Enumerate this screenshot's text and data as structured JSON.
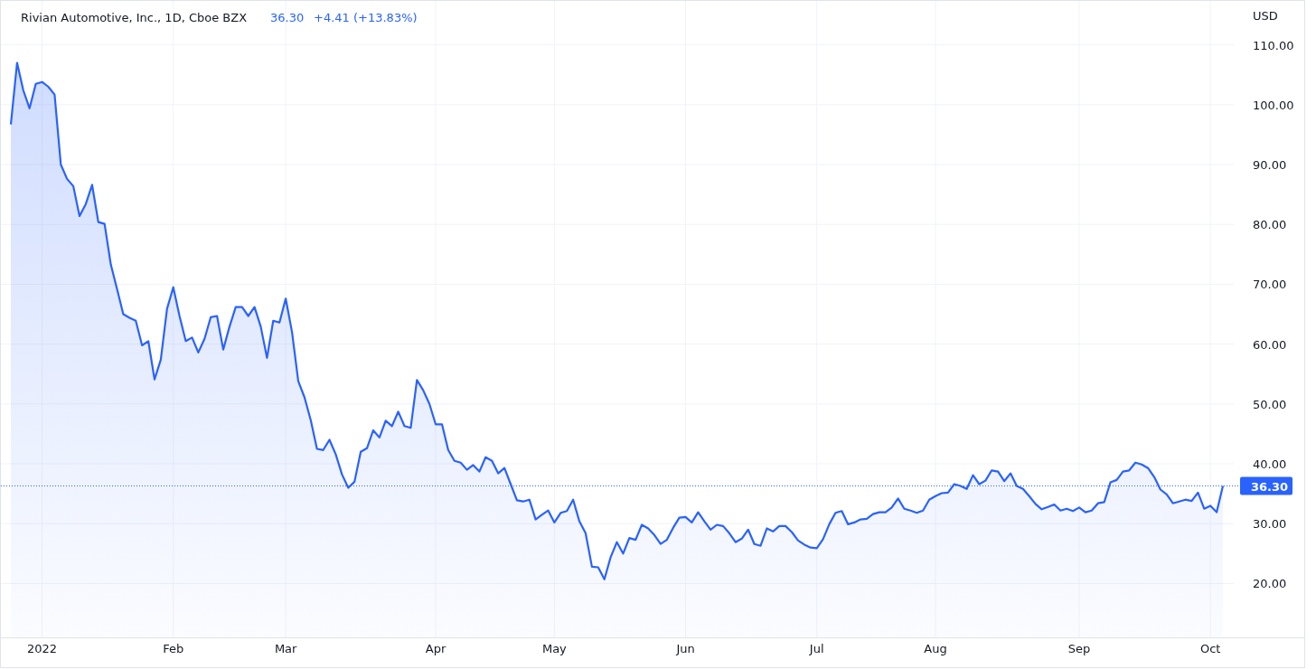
{
  "header": {
    "title": "Rivian Automotive, Inc., 1D, Cboe BZX",
    "price": "36.30",
    "change": "+4.41 (+13.83%)"
  },
  "chart": {
    "currency": "USD",
    "chart_data": {
      "type": "area",
      "grid": true,
      "ylim": [
        11,
        117.5
      ],
      "ref_lines": [
        {
          "axis": "y",
          "value": 36.3,
          "label": "36.30",
          "color": "#2962ff"
        }
      ],
      "categories": [
        null,
        null,
        null,
        null,
        null,
        "2022",
        null,
        null,
        null,
        null,
        null,
        null,
        null,
        null,
        null,
        null,
        null,
        null,
        null,
        null,
        null,
        null,
        null,
        null,
        null,
        null,
        "Feb",
        null,
        null,
        null,
        null,
        null,
        null,
        null,
        null,
        null,
        null,
        null,
        null,
        null,
        null,
        null,
        null,
        null,
        "Mar",
        null,
        null,
        null,
        null,
        null,
        null,
        null,
        null,
        null,
        null,
        null,
        null,
        null,
        null,
        null,
        null,
        null,
        null,
        null,
        null,
        null,
        null,
        null,
        "Apr",
        null,
        null,
        null,
        null,
        null,
        null,
        null,
        null,
        null,
        null,
        null,
        null,
        null,
        null,
        null,
        null,
        null,
        null,
        "May",
        null,
        null,
        null,
        null,
        null,
        null,
        null,
        null,
        null,
        null,
        null,
        null,
        null,
        null,
        null,
        null,
        null,
        null,
        null,
        null,
        "Jun",
        null,
        null,
        null,
        null,
        null,
        null,
        null,
        null,
        null,
        null,
        null,
        null,
        null,
        null,
        null,
        null,
        null,
        null,
        null,
        null,
        "Jul",
        null,
        null,
        null,
        null,
        null,
        null,
        null,
        null,
        null,
        null,
        null,
        null,
        null,
        null,
        null,
        null,
        null,
        null,
        "Aug",
        null,
        null,
        null,
        null,
        null,
        null,
        null,
        null,
        null,
        null,
        null,
        null,
        null,
        null,
        null,
        null,
        null,
        null,
        null,
        null,
        null,
        null,
        "Sep",
        null,
        null,
        null,
        null,
        null,
        null,
        null,
        null,
        null,
        null,
        null,
        null,
        null,
        null,
        null,
        null,
        null,
        null,
        null,
        null,
        "Oct",
        null,
        null
      ],
      "yticks": [
        {
          "value": 20,
          "label": "20.00"
        },
        {
          "value": 30,
          "label": "30.00"
        },
        {
          "value": 40,
          "label": "40.00"
        },
        {
          "value": 50,
          "label": "50.00"
        },
        {
          "value": 60,
          "label": "60.00"
        },
        {
          "value": 70,
          "label": "70.00"
        },
        {
          "value": 80,
          "label": "80.00"
        },
        {
          "value": 90,
          "label": "90.00"
        },
        {
          "value": 100,
          "label": "100.00"
        },
        {
          "value": 110,
          "label": "110.00"
        }
      ],
      "series": [
        {
          "color": "#2962ff",
          "values": [
            96.7,
            107,
            102.4,
            99.4,
            103.5,
            103.8,
            103,
            101.7,
            90,
            87.6,
            86.4,
            81.4,
            83.4,
            86.6,
            80.4,
            80.1,
            73.3,
            69.2,
            65,
            64.4,
            63.9,
            59.8,
            60.5,
            54.1,
            57.4,
            65.9,
            69.5,
            64.7,
            60.5,
            61.1,
            58.6,
            60.9,
            64.5,
            64.7,
            59.1,
            62.9,
            66.2,
            66.2,
            64.7,
            66.2,
            62.9,
            57.7,
            63.9,
            63.6,
            67.6,
            62,
            53.8,
            51.1,
            47.3,
            42.5,
            42.3,
            44,
            41.6,
            38.2,
            36,
            37,
            42,
            42.6,
            45.6,
            44.4,
            47.2,
            46.3,
            48.7,
            46.3,
            46,
            54,
            52.3,
            50,
            46.6,
            46.6,
            42.3,
            40.5,
            40.2,
            39,
            39.8,
            38.7,
            41.1,
            40.5,
            38.4,
            39.3,
            36.6,
            33.9,
            33.7,
            34,
            30.7,
            31.5,
            32.2,
            30.2,
            31.8,
            32.1,
            34,
            30.4,
            28.4,
            22.8,
            22.7,
            20.7,
            24.4,
            26.9,
            25,
            27.6,
            27.3,
            29.8,
            29.2,
            28.1,
            26.6,
            27.3,
            29.3,
            31,
            31.1,
            30.2,
            31.9,
            30.4,
            29,
            29.8,
            29.6,
            28.4,
            26.9,
            27.5,
            29,
            26.6,
            26.3,
            29.2,
            28.7,
            29.6,
            29.6,
            28.6,
            27.2,
            26.5,
            26,
            25.9,
            27.4,
            29.9,
            31.8,
            32.1,
            29.9,
            30.2,
            30.7,
            30.8,
            31.6,
            31.9,
            31.9,
            32.7,
            34.2,
            32.5,
            32.2,
            31.8,
            32.2,
            34,
            34.6,
            35.1,
            35.2,
            36.6,
            36.3,
            35.8,
            38.1,
            36.6,
            37.2,
            38.9,
            38.7,
            37.1,
            38.4,
            36.3,
            35.8,
            34.6,
            33.3,
            32.4,
            32.8,
            33.2,
            32.2,
            32.5,
            32.1,
            32.7,
            31.9,
            32.2,
            33.4,
            33.6,
            36.9,
            37.3,
            38.7,
            38.9,
            40.2,
            39.9,
            39.3,
            37.8,
            35.7,
            34.9,
            33.4,
            33.7,
            34,
            33.8,
            35.2,
            32.5,
            33,
            31.9,
            36.3
          ]
        }
      ]
    }
  }
}
